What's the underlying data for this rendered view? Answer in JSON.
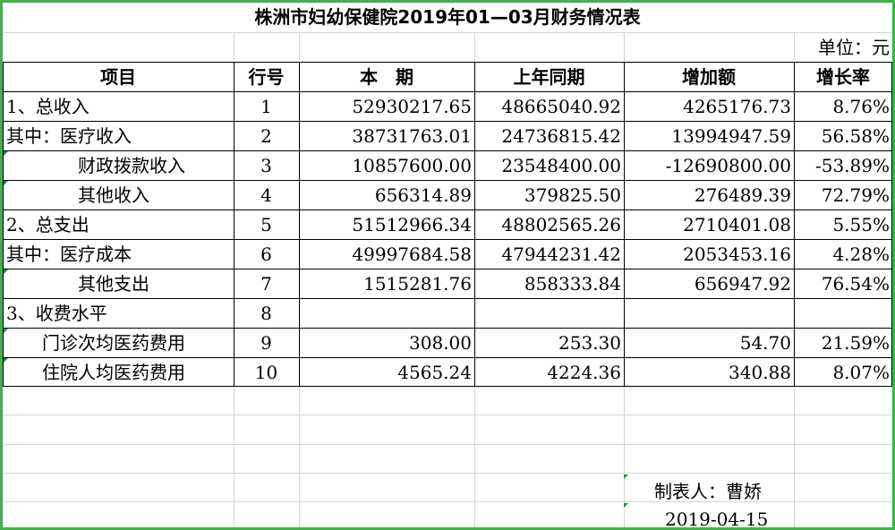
{
  "title": "株洲市妇幼保健院2019年01—03月财务情况表",
  "unit_label": "单位：元",
  "headers": [
    "项目",
    "行号",
    "本　期",
    "上年同期",
    "增加额",
    "增长率"
  ],
  "rows": [
    {
      "item": "1、总收入",
      "no": "1",
      "cur": "52930217.65",
      "prev": "48665040.92",
      "inc": "4265176.73",
      "rate": "8.76%"
    },
    {
      "item": "其中：医疗收入",
      "no": "2",
      "cur": "38731763.01",
      "prev": "24736815.42",
      "inc": "13994947.59",
      "rate": "56.58%"
    },
    {
      "item": "财政拨款收入",
      "no": "3",
      "cur": "10857600.00",
      "prev": "23548400.00",
      "inc": "-12690800.00",
      "rate": "-53.89%"
    },
    {
      "item": "其他收入",
      "no": "4",
      "cur": "656314.89",
      "prev": "379825.50",
      "inc": "276489.39",
      "rate": "72.79%"
    },
    {
      "item": "2、总支出",
      "no": "5",
      "cur": "51512966.34",
      "prev": "48802565.26",
      "inc": "2710401.08",
      "rate": "5.55%"
    },
    {
      "item": "其中：医疗成本",
      "no": "6",
      "cur": "49997684.58",
      "prev": "47944231.42",
      "inc": "2053453.16",
      "rate": "4.28%"
    },
    {
      "item": "其他支出",
      "no": "7",
      "cur": "1515281.76",
      "prev": "858333.84",
      "inc": "656947.92",
      "rate": "76.54%"
    },
    {
      "item": "3、收费水平",
      "no": "8",
      "cur": "",
      "prev": "",
      "inc": "",
      "rate": ""
    },
    {
      "item": "门诊次均医药费用",
      "no": "9",
      "cur": "308.00",
      "prev": "253.30",
      "inc": "54.70",
      "rate": "21.59%"
    },
    {
      "item": "住院人均医药费用",
      "no": "10",
      "cur": "4565.24",
      "prev": "4224.36",
      "inc": "340.88",
      "rate": "8.07%"
    }
  ],
  "preparer": "制表人：曹娇",
  "date": "2019-04-15",
  "colors": {
    "frame": "#3cb44a",
    "gridlight": "#d4d4d4",
    "triangle": "#1e8f2e"
  }
}
